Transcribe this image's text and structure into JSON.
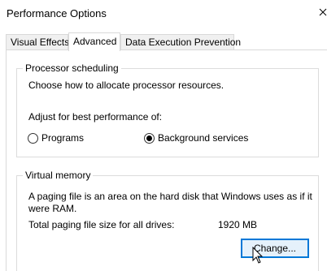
{
  "window": {
    "title": "Performance Options"
  },
  "tabs": [
    {
      "label": "Visual Effects",
      "active": false
    },
    {
      "label": "Advanced",
      "active": true
    },
    {
      "label": "Data Execution Prevention",
      "active": false
    }
  ],
  "processor_scheduling": {
    "legend": "Processor scheduling",
    "description": "Choose how to allocate processor resources.",
    "adjust_label": "Adjust for best performance of:",
    "options": [
      {
        "label": "Programs",
        "checked": false
      },
      {
        "label": "Background services",
        "checked": true
      }
    ]
  },
  "virtual_memory": {
    "legend": "Virtual memory",
    "description_line1": "A paging file is an area on the hard disk that Windows uses as if it",
    "description_line2": "were RAM.",
    "total_label": "Total paging file size for all drives:",
    "total_value": "1920 MB",
    "change_button": "Change..."
  },
  "icons": {
    "close": "close-icon",
    "cursor": "mouse-pointer-icon"
  }
}
